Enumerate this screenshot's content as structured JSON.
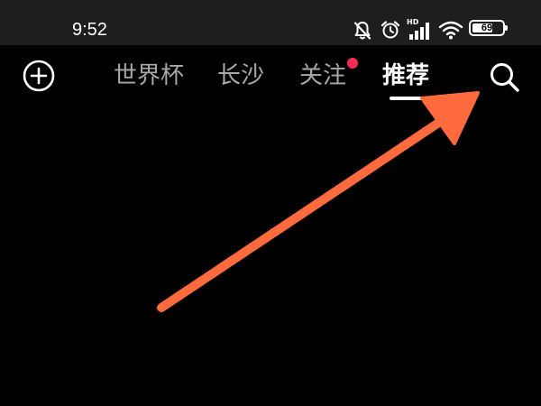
{
  "status_bar": {
    "time": "9:52",
    "icons": [
      "mute-icon",
      "alarm-icon",
      "hd-signal-icon",
      "wifi-icon",
      "battery-icon"
    ],
    "hd_label": "HD",
    "battery_level": "69",
    "battery_fraction": 0.69
  },
  "top_nav": {
    "add_icon": "plus-circle-icon",
    "tabs": [
      {
        "label": "世界杯",
        "active": false
      },
      {
        "label": "长沙",
        "active": false
      },
      {
        "label": "关注",
        "active": false,
        "badge": "red-dot"
      },
      {
        "label": "推荐",
        "active": true
      }
    ],
    "search_icon": "search-icon"
  },
  "annotation": {
    "type": "arrow",
    "color": "#ff6b3d",
    "points_to": "search-button"
  },
  "colors": {
    "background": "#000000",
    "status_bar": "#1e1e1e",
    "tab_inactive": "#a8a8a8",
    "tab_active": "#ffffff",
    "badge": "#fe2c55",
    "arrow": "#ff6b3d"
  }
}
